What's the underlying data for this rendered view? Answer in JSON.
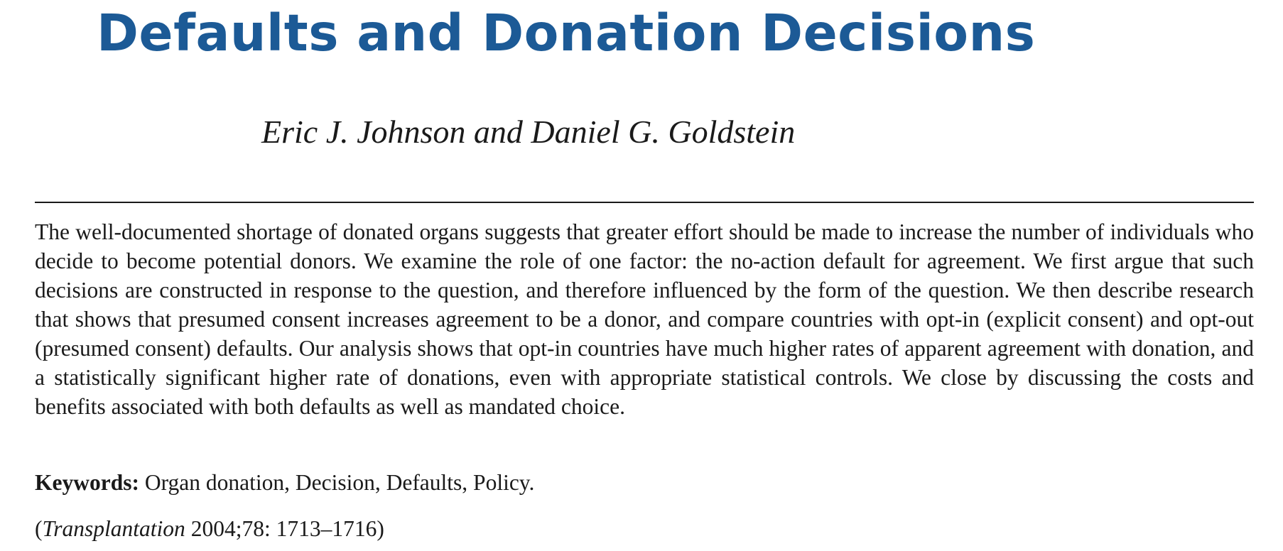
{
  "article": {
    "title": "Defaults and Donation Decisions",
    "authors": "Eric J. Johnson and Daniel G. Goldstein",
    "abstract": "The well-documented shortage of donated organs suggests that greater effort should be made to increase the number of individuals who decide to become potential donors. We examine the role of one factor: the no-action default for agreement. We first argue that such decisions are constructed in response to the question, and therefore influenced by the form of the question. We then describe research that shows that presumed consent increases agreement to be a donor, and compare countries with opt-in (explicit consent) and opt-out (presumed consent) defaults. Our analysis shows that opt-in countries have much higher rates of apparent agreement with donation, and a statistically significant higher rate of donations, even with appropriate statistical controls. We close by discussing the costs and benefits associated with both defaults as well as mandated choice.",
    "keywords_label": "Keywords:",
    "keywords": "Organ donation, Decision, Defaults, Policy.",
    "citation": {
      "open_paren": "(",
      "journal": "Transplantation",
      "details": " 2004;78: 1713–1716)"
    }
  },
  "colors": {
    "title": "#1c5a96",
    "text": "#1a1a1a"
  }
}
